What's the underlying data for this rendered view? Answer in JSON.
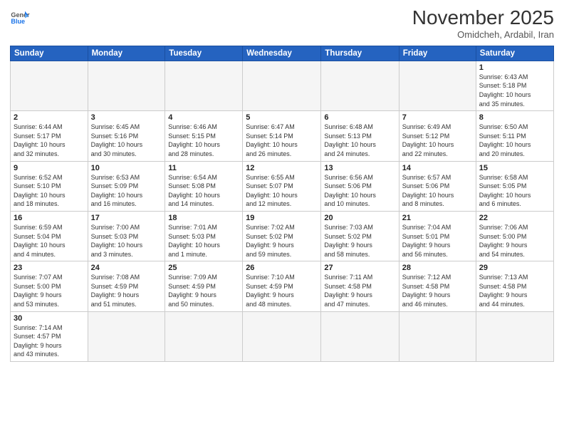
{
  "logo": {
    "line1": "General",
    "line2": "Blue"
  },
  "title": "November 2025",
  "location": "Omidcheh, Ardabil, Iran",
  "weekdays": [
    "Sunday",
    "Monday",
    "Tuesday",
    "Wednesday",
    "Thursday",
    "Friday",
    "Saturday"
  ],
  "weeks": [
    [
      {
        "day": "",
        "info": ""
      },
      {
        "day": "",
        "info": ""
      },
      {
        "day": "",
        "info": ""
      },
      {
        "day": "",
        "info": ""
      },
      {
        "day": "",
        "info": ""
      },
      {
        "day": "",
        "info": ""
      },
      {
        "day": "1",
        "info": "Sunrise: 6:43 AM\nSunset: 5:18 PM\nDaylight: 10 hours\nand 35 minutes."
      }
    ],
    [
      {
        "day": "2",
        "info": "Sunrise: 6:44 AM\nSunset: 5:17 PM\nDaylight: 10 hours\nand 32 minutes."
      },
      {
        "day": "3",
        "info": "Sunrise: 6:45 AM\nSunset: 5:16 PM\nDaylight: 10 hours\nand 30 minutes."
      },
      {
        "day": "4",
        "info": "Sunrise: 6:46 AM\nSunset: 5:15 PM\nDaylight: 10 hours\nand 28 minutes."
      },
      {
        "day": "5",
        "info": "Sunrise: 6:47 AM\nSunset: 5:14 PM\nDaylight: 10 hours\nand 26 minutes."
      },
      {
        "day": "6",
        "info": "Sunrise: 6:48 AM\nSunset: 5:13 PM\nDaylight: 10 hours\nand 24 minutes."
      },
      {
        "day": "7",
        "info": "Sunrise: 6:49 AM\nSunset: 5:12 PM\nDaylight: 10 hours\nand 22 minutes."
      },
      {
        "day": "8",
        "info": "Sunrise: 6:50 AM\nSunset: 5:11 PM\nDaylight: 10 hours\nand 20 minutes."
      }
    ],
    [
      {
        "day": "9",
        "info": "Sunrise: 6:52 AM\nSunset: 5:10 PM\nDaylight: 10 hours\nand 18 minutes."
      },
      {
        "day": "10",
        "info": "Sunrise: 6:53 AM\nSunset: 5:09 PM\nDaylight: 10 hours\nand 16 minutes."
      },
      {
        "day": "11",
        "info": "Sunrise: 6:54 AM\nSunset: 5:08 PM\nDaylight: 10 hours\nand 14 minutes."
      },
      {
        "day": "12",
        "info": "Sunrise: 6:55 AM\nSunset: 5:07 PM\nDaylight: 10 hours\nand 12 minutes."
      },
      {
        "day": "13",
        "info": "Sunrise: 6:56 AM\nSunset: 5:06 PM\nDaylight: 10 hours\nand 10 minutes."
      },
      {
        "day": "14",
        "info": "Sunrise: 6:57 AM\nSunset: 5:06 PM\nDaylight: 10 hours\nand 8 minutes."
      },
      {
        "day": "15",
        "info": "Sunrise: 6:58 AM\nSunset: 5:05 PM\nDaylight: 10 hours\nand 6 minutes."
      }
    ],
    [
      {
        "day": "16",
        "info": "Sunrise: 6:59 AM\nSunset: 5:04 PM\nDaylight: 10 hours\nand 4 minutes."
      },
      {
        "day": "17",
        "info": "Sunrise: 7:00 AM\nSunset: 5:03 PM\nDaylight: 10 hours\nand 3 minutes."
      },
      {
        "day": "18",
        "info": "Sunrise: 7:01 AM\nSunset: 5:03 PM\nDaylight: 10 hours\nand 1 minute."
      },
      {
        "day": "19",
        "info": "Sunrise: 7:02 AM\nSunset: 5:02 PM\nDaylight: 9 hours\nand 59 minutes."
      },
      {
        "day": "20",
        "info": "Sunrise: 7:03 AM\nSunset: 5:02 PM\nDaylight: 9 hours\nand 58 minutes."
      },
      {
        "day": "21",
        "info": "Sunrise: 7:04 AM\nSunset: 5:01 PM\nDaylight: 9 hours\nand 56 minutes."
      },
      {
        "day": "22",
        "info": "Sunrise: 7:06 AM\nSunset: 5:00 PM\nDaylight: 9 hours\nand 54 minutes."
      }
    ],
    [
      {
        "day": "23",
        "info": "Sunrise: 7:07 AM\nSunset: 5:00 PM\nDaylight: 9 hours\nand 53 minutes."
      },
      {
        "day": "24",
        "info": "Sunrise: 7:08 AM\nSunset: 4:59 PM\nDaylight: 9 hours\nand 51 minutes."
      },
      {
        "day": "25",
        "info": "Sunrise: 7:09 AM\nSunset: 4:59 PM\nDaylight: 9 hours\nand 50 minutes."
      },
      {
        "day": "26",
        "info": "Sunrise: 7:10 AM\nSunset: 4:59 PM\nDaylight: 9 hours\nand 48 minutes."
      },
      {
        "day": "27",
        "info": "Sunrise: 7:11 AM\nSunset: 4:58 PM\nDaylight: 9 hours\nand 47 minutes."
      },
      {
        "day": "28",
        "info": "Sunrise: 7:12 AM\nSunset: 4:58 PM\nDaylight: 9 hours\nand 46 minutes."
      },
      {
        "day": "29",
        "info": "Sunrise: 7:13 AM\nSunset: 4:58 PM\nDaylight: 9 hours\nand 44 minutes."
      }
    ],
    [
      {
        "day": "30",
        "info": "Sunrise: 7:14 AM\nSunset: 4:57 PM\nDaylight: 9 hours\nand 43 minutes."
      },
      {
        "day": "",
        "info": ""
      },
      {
        "day": "",
        "info": ""
      },
      {
        "day": "",
        "info": ""
      },
      {
        "day": "",
        "info": ""
      },
      {
        "day": "",
        "info": ""
      },
      {
        "day": "",
        "info": ""
      }
    ]
  ]
}
